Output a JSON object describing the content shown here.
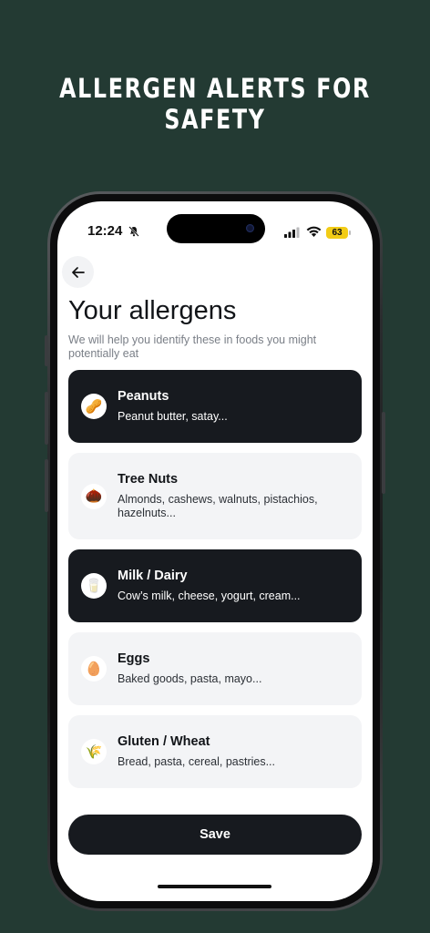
{
  "promo": {
    "headline": "ALLERGEN ALERTS FOR SAFETY"
  },
  "status_bar": {
    "time": "12:24",
    "battery": "63"
  },
  "page": {
    "title": "Your allergens",
    "subtitle": "We will help you identify these in foods you might potentially eat"
  },
  "allergens": [
    {
      "name": "Peanuts",
      "desc": "Peanut butter, satay...",
      "emoji": "🥜",
      "selected": true
    },
    {
      "name": "Tree Nuts",
      "desc": "Almonds, cashews, walnuts, pistachios, hazelnuts...",
      "emoji": "🌰",
      "selected": false
    },
    {
      "name": "Milk / Dairy",
      "desc": "Cow’s milk, cheese, yogurt, cream...",
      "emoji": "🥛",
      "selected": true
    },
    {
      "name": "Eggs",
      "desc": "Baked goods, pasta, mayo...",
      "emoji": "🥚",
      "selected": false
    },
    {
      "name": "Gluten / Wheat",
      "desc": "Bread, pasta, cereal, pastries...",
      "emoji": "🌾",
      "selected": false
    }
  ],
  "actions": {
    "save_label": "Save"
  },
  "colors": {
    "background": "#233a33",
    "selected_card": "#171a1f",
    "unselected_card": "#f3f4f6",
    "battery": "#f2cc16"
  }
}
